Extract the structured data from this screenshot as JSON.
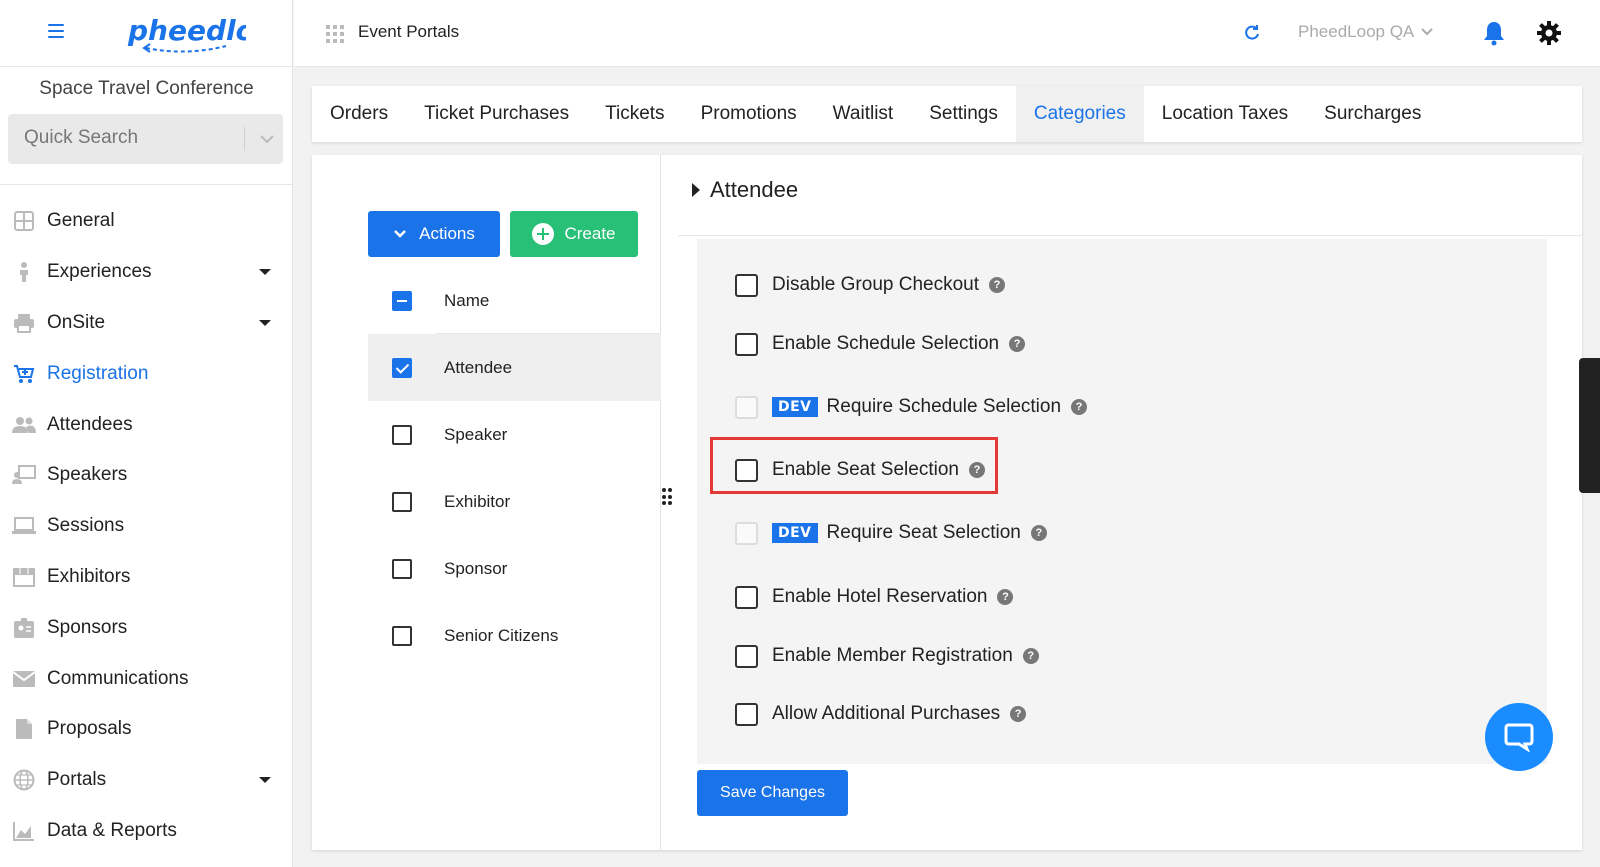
{
  "brand": {
    "logo_text": "pheedloop",
    "accent": "#1a73e8",
    "create_color": "#28c077",
    "highlight_color": "#e53935"
  },
  "sidebar": {
    "event_name": "Space Travel Conference",
    "search_placeholder": "Quick Search",
    "items": [
      {
        "label": "General",
        "icon": "grid-icon",
        "expandable": false
      },
      {
        "label": "Experiences",
        "icon": "person-icon",
        "expandable": true
      },
      {
        "label": "OnSite",
        "icon": "printer-icon",
        "expandable": true
      },
      {
        "label": "Registration",
        "icon": "cart-icon",
        "expandable": false,
        "active": true
      },
      {
        "label": "Attendees",
        "icon": "people-icon",
        "expandable": false
      },
      {
        "label": "Speakers",
        "icon": "presenter-icon",
        "expandable": false
      },
      {
        "label": "Sessions",
        "icon": "laptop-icon",
        "expandable": false
      },
      {
        "label": "Exhibitors",
        "icon": "store-icon",
        "expandable": false
      },
      {
        "label": "Sponsors",
        "icon": "badge-icon",
        "expandable": false
      },
      {
        "label": "Communications",
        "icon": "mail-icon",
        "expandable": false
      },
      {
        "label": "Proposals",
        "icon": "document-icon",
        "expandable": false
      },
      {
        "label": "Portals",
        "icon": "globe-icon",
        "expandable": true
      },
      {
        "label": "Data & Reports",
        "icon": "chart-icon",
        "expandable": false
      }
    ]
  },
  "topbar": {
    "title": "Event Portals",
    "org": "PheedLoop QA"
  },
  "tabs": [
    "Orders",
    "Ticket Purchases",
    "Tickets",
    "Promotions",
    "Waitlist",
    "Settings",
    "Categories",
    "Location Taxes",
    "Surcharges"
  ],
  "active_tab": "Categories",
  "actions": {
    "actions_label": "Actions",
    "create_label": "Create"
  },
  "categories": {
    "header": "Name",
    "rows": [
      {
        "name": "Attendee",
        "checked": true
      },
      {
        "name": "Speaker",
        "checked": false
      },
      {
        "name": "Exhibitor",
        "checked": false
      },
      {
        "name": "Sponsor",
        "checked": false
      },
      {
        "name": "Senior Citizens",
        "checked": false
      }
    ]
  },
  "detail": {
    "section_title": "Attendee",
    "options": [
      {
        "label": "Disable Group Checkout",
        "dev": false,
        "disabled": false
      },
      {
        "label": "Enable Schedule Selection",
        "dev": false,
        "disabled": false
      },
      {
        "label": "Require Schedule Selection",
        "dev": true,
        "disabled": true
      },
      {
        "label": "Enable Seat Selection",
        "dev": false,
        "disabled": false,
        "highlighted": true
      },
      {
        "label": "Require Seat Selection",
        "dev": true,
        "disabled": true
      },
      {
        "label": "Enable Hotel Reservation",
        "dev": false,
        "disabled": false
      },
      {
        "label": "Enable Member Registration",
        "dev": false,
        "disabled": false
      },
      {
        "label": "Allow Additional Purchases",
        "dev": false,
        "disabled": false
      }
    ],
    "dev_badge": "DEV",
    "help_glyph": "?",
    "save_label": "Save Changes"
  }
}
